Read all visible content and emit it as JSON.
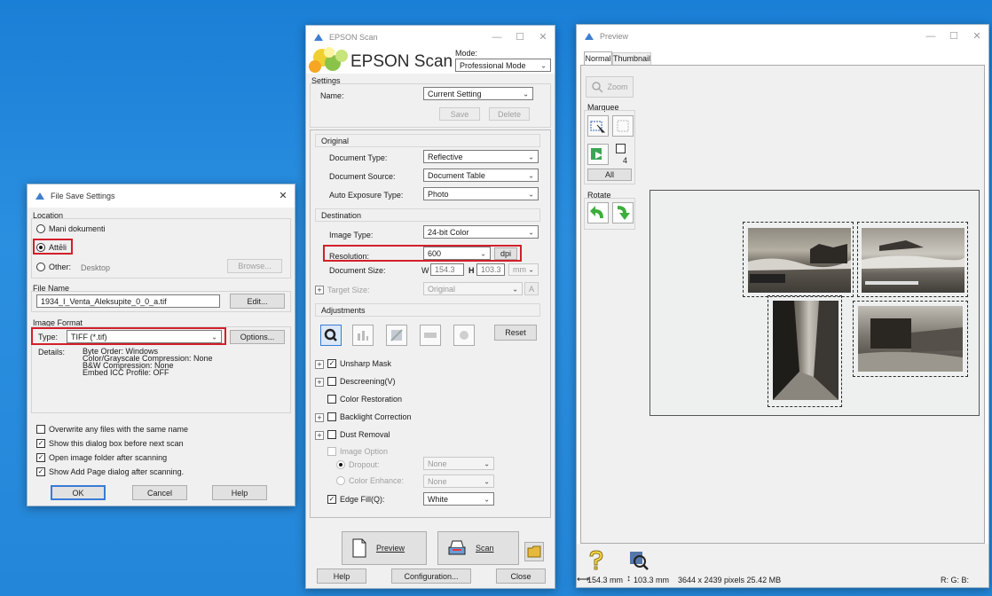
{
  "file_save": {
    "title": "File Save Settings",
    "close": "✕",
    "location_label": "Location",
    "radio_docs": "Mani dokumenti",
    "radio_pics": "Attēli",
    "radio_other": "Other:",
    "other_path": "Desktop",
    "browse": "Browse...",
    "filename_label": "File Name",
    "filename": "1934_I_Venta_Aleksupite_0_0_a.tif",
    "edit": "Edit...",
    "format_label": "Image Format",
    "type_label": "Type:",
    "type_value": "TIFF (*.tif)",
    "options": "Options...",
    "details_label": "Details:",
    "details_lines": [
      "Byte Order: Windows",
      "Color/Grayscale Compression: None",
      "B&W Compression: None",
      "Embed ICC Profile: OFF"
    ],
    "chk_overwrite": "Overwrite any files with the same name",
    "chk_show_dialog": "Show this dialog box before next scan",
    "chk_open_folder": "Open image folder after scanning",
    "chk_add_page": "Show Add Page dialog after scanning.",
    "ok": "OK",
    "cancel": "Cancel",
    "help": "Help"
  },
  "epson": {
    "title": "EPSON Scan",
    "logo": "EPSON Scan",
    "mode_label": "Mode:",
    "mode_value": "Professional Mode",
    "settings_label": "Settings",
    "name_label": "Name:",
    "name_value": "Current Setting",
    "save": "Save",
    "delete": "Delete",
    "original_head": "Original",
    "doc_type_label": "Document Type:",
    "doc_type_value": "Reflective",
    "doc_source_label": "Document Source:",
    "doc_source_value": "Document Table",
    "auto_exp_label": "Auto Exposure Type:",
    "auto_exp_value": "Photo",
    "destination_head": "Destination",
    "image_type_label": "Image Type:",
    "image_type_value": "24-bit Color",
    "resolution_label": "Resolution:",
    "resolution_value": "600",
    "dpi": "dpi",
    "doc_size_label": "Document Size:",
    "w_label": "W",
    "w_value": "154.3",
    "h_label": "H",
    "h_value": "103.3",
    "unit": "mm",
    "target_size_label": "Target Size:",
    "target_size_value": "Original",
    "adjustments_head": "Adjustments",
    "reset": "Reset",
    "unsharp": "Unsharp Mask",
    "descreening": "Descreening(V)",
    "color_restoration": "Color Restoration",
    "backlight": "Backlight Correction",
    "dust": "Dust Removal",
    "image_option": "Image Option",
    "dropout_label": "Dropout:",
    "dropout_value": "None",
    "color_enhance_label": "Color Enhance:",
    "color_enhance_value": "None",
    "edge_fill_label": "Edge Fill(Q):",
    "edge_fill_value": "White",
    "preview_btn": "Preview",
    "scan_btn": "Scan",
    "help": "Help",
    "configuration": "Configuration...",
    "close": "Close"
  },
  "preview": {
    "title": "Preview",
    "tab_normal": "Normal",
    "tab_thumbnail": "Thumbnail",
    "zoom": "Zoom",
    "marquee_label": "Marquee",
    "marquee_count": "4",
    "all": "All",
    "rotate_label": "Rotate",
    "status_size": "154.3 mm",
    "status_height": "103.3 mm",
    "status_pixels": "3644 x 2439 pixels 25.42 MB",
    "status_rgb": "R: G: B:"
  }
}
